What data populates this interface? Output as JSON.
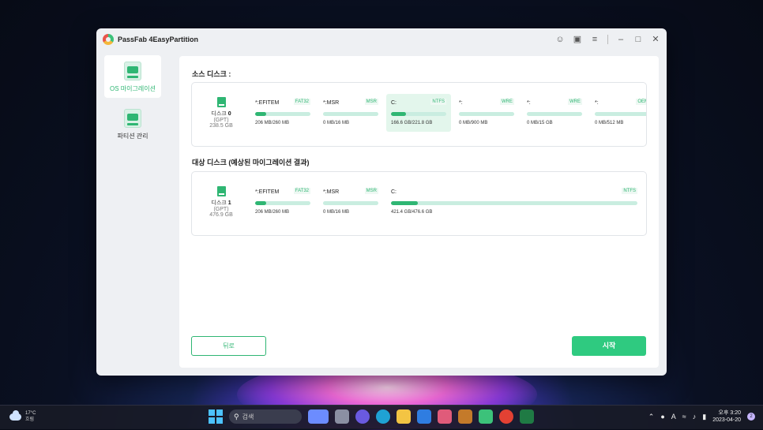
{
  "window": {
    "title": "PassFab 4EasyPartition",
    "controls": [
      "user-icon",
      "feedback-icon",
      "menu-icon",
      "minimize-icon",
      "maximize-icon",
      "close-icon"
    ]
  },
  "sidebar": {
    "items": [
      {
        "label": "OS 마이그레이션",
        "active": true,
        "icon": "disk-migration-icon"
      },
      {
        "label": "파티션 관리",
        "active": false,
        "icon": "partition-pie-icon"
      }
    ]
  },
  "source": {
    "title": "소스 디스크 :",
    "disk": {
      "name": "디스크",
      "index": "0",
      "type": "(GPT)",
      "size": "238.5 GB"
    },
    "partitions": [
      {
        "name": "*:EFITEM",
        "fs": "FAT32",
        "size": "206 MB/260 MB",
        "fill": 0.2,
        "selected": false
      },
      {
        "name": "*:MSR",
        "fs": "MSR",
        "size": "0 MB/16 MB",
        "fill": 0.0,
        "selected": false
      },
      {
        "name": "C:",
        "fs": "NTFS",
        "size": "166.6 GB/221.8 GB",
        "fill": 0.27,
        "selected": true
      },
      {
        "name": "*:",
        "fs": "WRE",
        "size": "0 MB/900 MB",
        "fill": 0.0,
        "selected": false
      },
      {
        "name": "*:",
        "fs": "WRE",
        "size": "0 MB/15 GB",
        "fill": 0.0,
        "selected": false
      },
      {
        "name": "*:",
        "fs": "OEM",
        "size": "0 MB/512 MB",
        "fill": 0.0,
        "selected": false
      }
    ]
  },
  "target": {
    "title": "대상 디스크 (예상된 마이그레이션 결과)",
    "disk": {
      "name": "디스크",
      "index": "1",
      "type": "(GPT)",
      "size": "476.9 GB"
    },
    "partitions": [
      {
        "name": "*:EFITEM",
        "fs": "FAT32",
        "size": "206 MB/260 MB",
        "fill": 0.2
      },
      {
        "name": "*:MSR",
        "fs": "MSR",
        "size": "0 MB/16 MB",
        "fill": 0.0
      },
      {
        "name": "C:",
        "fs": "NTFS",
        "size": "421.4 GB/476.6 GB",
        "fill": 0.11
      }
    ]
  },
  "buttons": {
    "back": "뒤로",
    "start": "시작"
  },
  "accent_color": "#2fb673",
  "taskbar": {
    "weather": {
      "temp": "17°C",
      "condition": "흐림"
    },
    "search_placeholder": "검색",
    "clock": {
      "time": "오후 3:20",
      "date": "2023-04-20"
    },
    "notifications": "2",
    "tray_lang": "A"
  }
}
